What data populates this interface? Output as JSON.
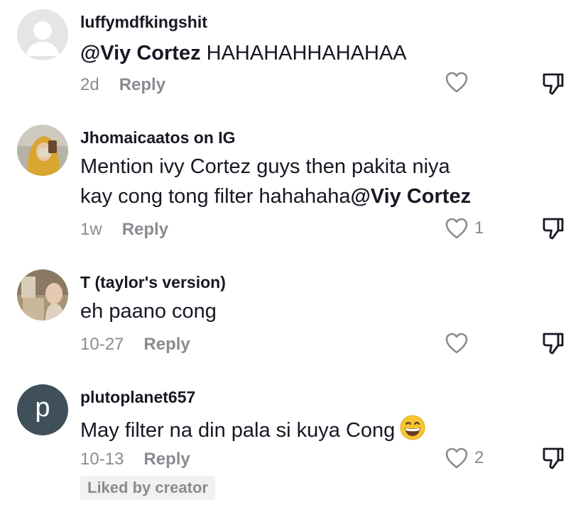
{
  "comments": [
    {
      "username": "luffymdfkingshit",
      "mention": "@Viy Cortez",
      "text": " HAHAHAHHAHAHAA",
      "time": "2d",
      "reply_label": "Reply",
      "likes": ""
    },
    {
      "username": "Jhomaicaatos on IG",
      "text_line1": "Mention ivy Cortez guys then pakita niya",
      "text_line2": "kay cong tong filter hahahaha",
      "mention": "@Viy Cortez",
      "time": "1w",
      "reply_label": "Reply",
      "likes": "1"
    },
    {
      "username": "T (taylor's version)",
      "text": "eh paano cong",
      "time": "10-27",
      "reply_label": "Reply",
      "likes": ""
    },
    {
      "username": "plutoplanet657",
      "avatar_letter": "p",
      "text": "May filter na din pala si kuya Cong",
      "time": "10-13",
      "reply_label": "Reply",
      "likes": "2",
      "badge": "Liked by creator"
    }
  ],
  "colors": {
    "text": "#161823",
    "muted": "#8a8b91",
    "avatar_letter_bg": "#3f505b",
    "badge_bg": "#f1f1f2"
  }
}
